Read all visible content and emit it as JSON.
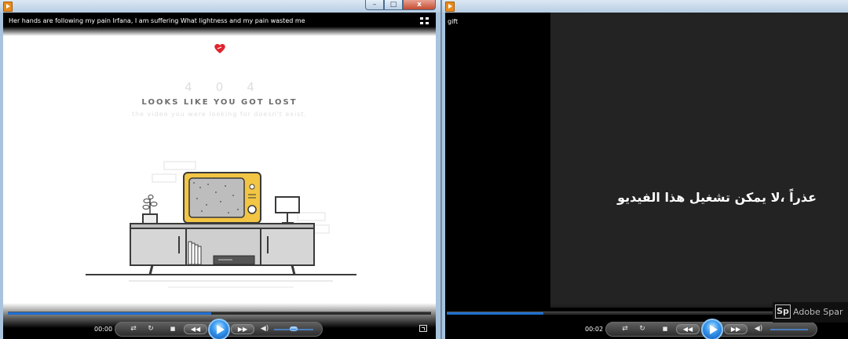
{
  "left_window": {
    "title_controls": [
      "–",
      "□",
      "x"
    ],
    "video_title": "Her hands are following my pain Irfana, I am suffering What lightness and my pain wasted me",
    "error": {
      "digits": "404",
      "heading": "LOOKS LIKE YOU GOT LOST",
      "subtext": "the video you were looking for doesn't exist."
    },
    "player": {
      "time": "00:00",
      "progress_percent": 48,
      "volume_percent": 50
    }
  },
  "right_window": {
    "title_controls": [],
    "video_title": "gift",
    "message": "عذراً ،لا يمكن تشغيل هذا الفيديو",
    "watermark": {
      "logo": "Sp",
      "text": "Adobe Spar"
    },
    "player": {
      "time": "00:02",
      "progress_percent": 24
    }
  },
  "icons": {
    "player": [
      "shuffle-icon",
      "repeat-icon",
      "stop-icon",
      "previous-icon",
      "play-icon",
      "next-icon",
      "volume-icon",
      "fullscreen-icon"
    ],
    "overlay": [
      "switch-view-icon",
      "heart-icon"
    ]
  },
  "colors": {
    "accent": "#1f6fd1",
    "heart": "#e0242d",
    "tv": "#f3c544"
  }
}
